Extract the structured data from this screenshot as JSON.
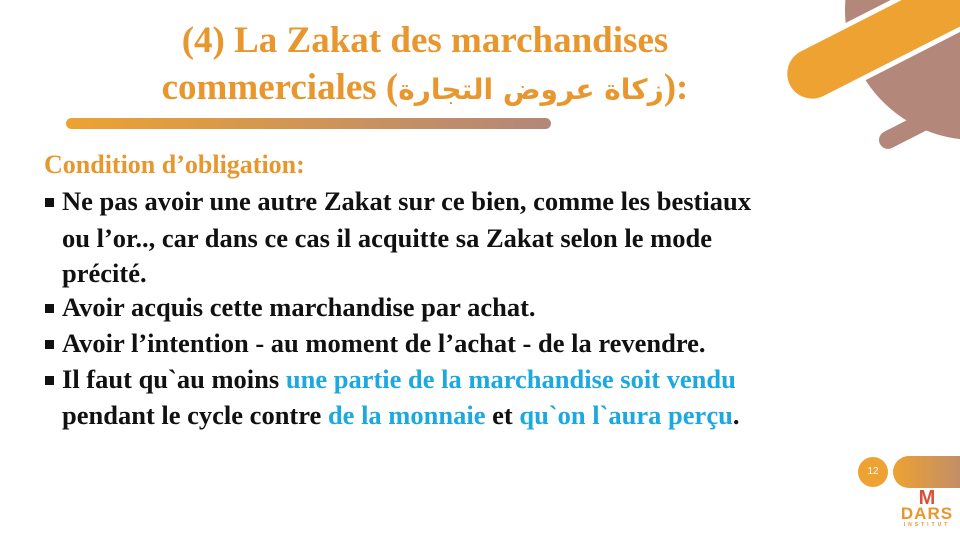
{
  "title": {
    "line1": "(4) La Zakat des marchandises",
    "line2_pre": "commerciales (",
    "line2_arabic": "زكاة عروض التجارة",
    "line2_post": "):"
  },
  "condition_heading": "Condition d’obligation:",
  "bullets": [
    {
      "lines": [
        "Ne pas avoir une autre Zakat sur ce bien, comme les bestiaux",
        "ou l’or.., car dans ce cas il acquitte sa Zakat selon le mode",
        "précité."
      ]
    },
    {
      "lines": [
        "Avoir acquis cette marchandise par achat."
      ]
    },
    {
      "lines": [
        "Avoir l’intention - au moment de l’achat - de la revendre."
      ]
    },
    {
      "parts": {
        "a": "Il faut qu`au moins ",
        "b": "une partie de la marchandise soit vendu",
        "c": "pendant le cycle contre ",
        "d": "de la monnaie",
        "e": " et ",
        "f": "qu`on l`aura perçu",
        "g": "."
      }
    }
  ],
  "page_number": "12",
  "logo": {
    "text": "DARS",
    "subtext": "INSTITUT"
  },
  "colors": {
    "orange": "#E8962E",
    "mauve": "#B3877A",
    "blue": "#1CA8E0"
  }
}
